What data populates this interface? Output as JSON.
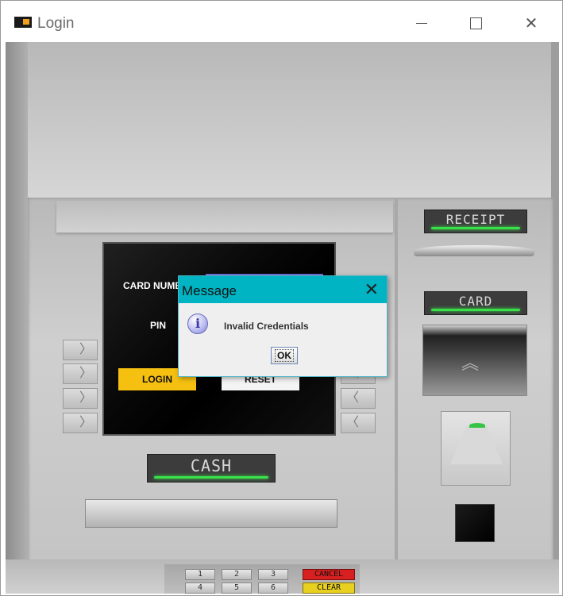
{
  "window": {
    "title": "Login"
  },
  "screen": {
    "card_number_label": "CARD NUMB",
    "pin_label": "PIN",
    "login_button": "LOGIN",
    "reset_button": "RESET"
  },
  "atm": {
    "cash_label": "CASH",
    "receipt_label": "RECEIPT",
    "card_label": "CARD"
  },
  "keypad": {
    "row1": [
      "1",
      "2",
      "3"
    ],
    "row2": [
      "4",
      "5",
      "6"
    ],
    "cancel": "CANCEL",
    "clear": "CLEAR"
  },
  "dialog": {
    "title": "Message",
    "message": "Invalid Credentials",
    "ok": "OK"
  },
  "colors": {
    "dialog_titlebar": "#00b4c3",
    "login_button": "#f5c010",
    "indicator_green": "#3ae04a",
    "cancel_key": "#d82020",
    "clear_key": "#e8d020"
  }
}
